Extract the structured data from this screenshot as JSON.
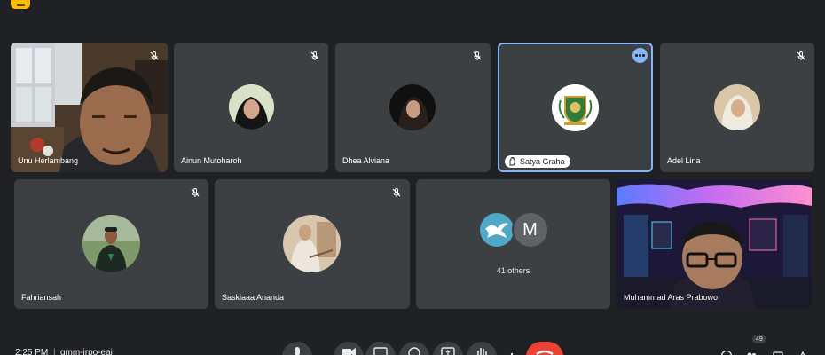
{
  "participants": [
    {
      "name": "Unu Herlambang",
      "muted": true,
      "video": true
    },
    {
      "name": "Ainun Mutoharoh",
      "muted": true,
      "video": false,
      "avatar": "photo-woman-hijab-black"
    },
    {
      "name": "Dhea Alviana",
      "muted": true,
      "video": false,
      "avatar": "photo-woman-dark"
    },
    {
      "name": "Satya Graha",
      "muted": false,
      "video": false,
      "active_speaker": true,
      "hand_raised": true,
      "avatar": "logo-emblem"
    },
    {
      "name": "Adel Lina",
      "muted": true,
      "video": false,
      "avatar": "photo-woman-hijab-light"
    },
    {
      "name": "Fahriansah",
      "muted": true,
      "video": false,
      "avatar": "photo-man-outdoor"
    },
    {
      "name": "Saskiaaa Ananda",
      "muted": true,
      "video": false,
      "avatar": "photo-woman-sketch"
    },
    {
      "name": "Muhammad Aras Prabowo",
      "muted": false,
      "video": true
    }
  ],
  "others": {
    "label": "41 others",
    "avatar_letter": "M",
    "colors": [
      "#4fa8c8",
      "#5f6368"
    ]
  },
  "bottom_bar": {
    "time": "2:25 PM",
    "separator": "|",
    "meeting_code": "gmm-irpo-eaj",
    "participant_count": "49"
  },
  "colors": {
    "background": "#202124",
    "tile": "#3c4043",
    "accent": "#8ab4f8",
    "end_call": "#ea4335",
    "app_badge": "#fbbc04"
  }
}
